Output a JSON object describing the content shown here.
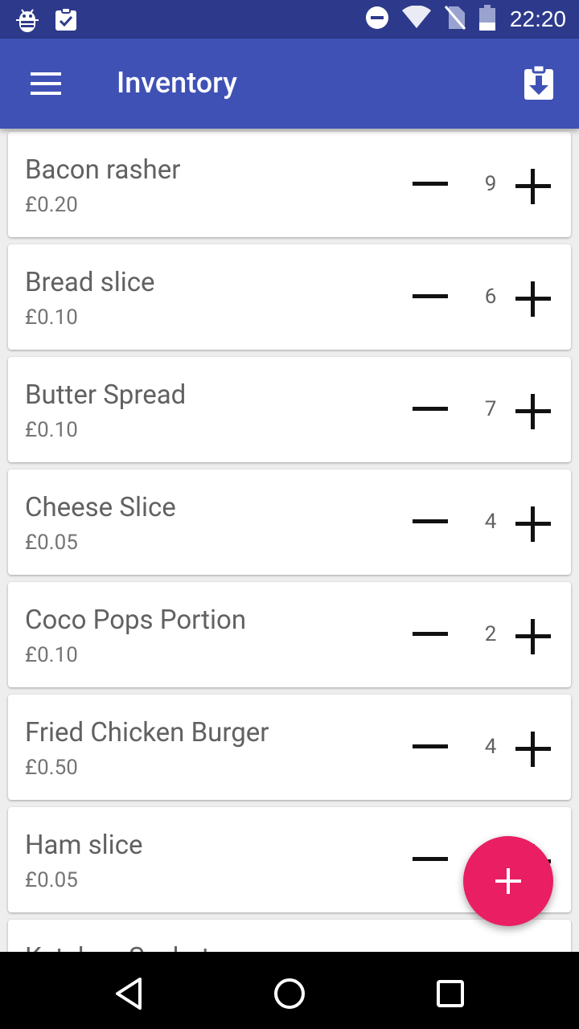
{
  "status_bar": {
    "time": "22:20",
    "icons": [
      "android-debug-icon",
      "clipboard-check-icon",
      "do-not-disturb-icon",
      "wifi-icon",
      "no-sim-icon",
      "battery-icon"
    ]
  },
  "app_bar": {
    "title": "Inventory",
    "menu_icon": "hamburger-menu-icon",
    "action_icon": "clipboard-download-icon"
  },
  "items": [
    {
      "name": "Bacon rasher",
      "price": "£0.20",
      "qty": "9"
    },
    {
      "name": "Bread slice",
      "price": "£0.10",
      "qty": "6"
    },
    {
      "name": "Butter Spread",
      "price": "£0.10",
      "qty": "7"
    },
    {
      "name": "Cheese Slice",
      "price": "£0.05",
      "qty": "4"
    },
    {
      "name": "Coco Pops Portion",
      "price": "£0.10",
      "qty": "2"
    },
    {
      "name": "Fried Chicken Burger",
      "price": "£0.50",
      "qty": "4"
    },
    {
      "name": "Ham slice",
      "price": "£0.05",
      "qty": ""
    },
    {
      "name": "Ketchup Sachet",
      "price": "",
      "qty": ""
    }
  ],
  "fab": {
    "icon": "add-icon"
  },
  "nav_bar": {
    "icons": [
      "back-icon",
      "home-icon",
      "recents-icon"
    ]
  },
  "colors": {
    "status_bar": "#2d3a8c",
    "app_bar": "#3f51b5",
    "fab": "#e91e63",
    "background": "#eeeeee"
  }
}
